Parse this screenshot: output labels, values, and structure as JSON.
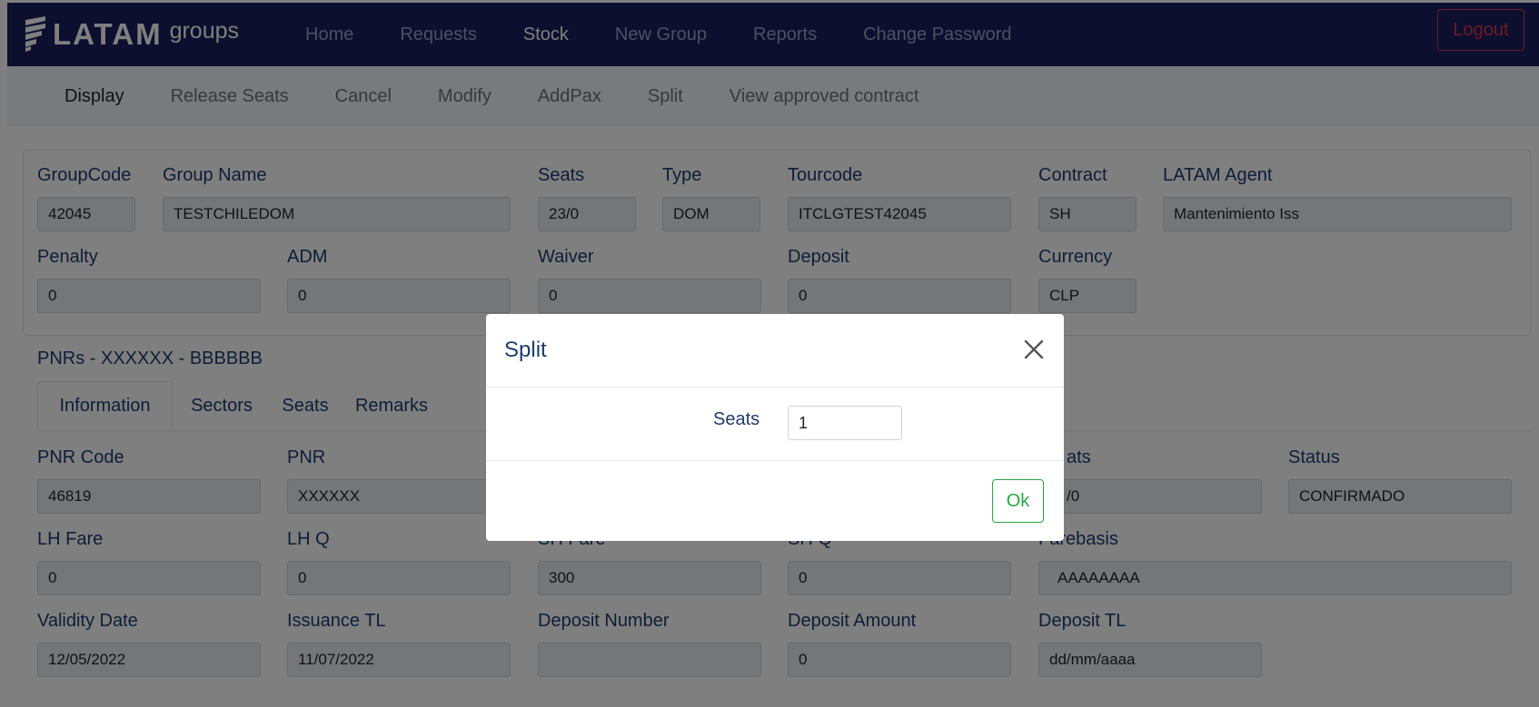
{
  "brand": {
    "name": "LATAM",
    "sub": "groups"
  },
  "nav": {
    "items": [
      "Home",
      "Requests",
      "Stock",
      "New Group",
      "Reports",
      "Change Password"
    ],
    "active": "Stock",
    "logout": "Logout"
  },
  "subnav": {
    "items": [
      "Display",
      "Release Seats",
      "Cancel",
      "Modify",
      "AddPax",
      "Split",
      "View approved contract"
    ]
  },
  "group": {
    "groupcode_label": "GroupCode",
    "groupcode": "42045",
    "groupname_label": "Group Name",
    "groupname": "TESTCHILEDOM",
    "seats_label": "Seats",
    "seats": "23/0",
    "type_label": "Type",
    "type": "DOM",
    "tourcode_label": "Tourcode",
    "tourcode": "ITCLGTEST42045",
    "contract_label": "Contract",
    "contract": "SH",
    "agent_label": "LATAM Agent",
    "agent": "Mantenimiento Iss",
    "penalty_label": "Penalty",
    "penalty": "0",
    "adm_label": "ADM",
    "adm": "0",
    "waiver_label": "Waiver",
    "waiver": "0",
    "deposit_label": "Deposit",
    "deposit": "0",
    "currency_label": "Currency",
    "currency": "CLP"
  },
  "pnrs": {
    "title": "PNRs - XXXXXX - BBBBBB",
    "tabs": [
      "Information",
      "Sectors",
      "Seats",
      "Remarks"
    ]
  },
  "pnr": {
    "code_label": "PNR Code",
    "code": "46819",
    "pnr_label": "PNR",
    "pnr": "XXXXXX",
    "seats_label_visible": "ats",
    "seats_visible": "/0",
    "status_label": "Status",
    "status": "CONFIRMADO",
    "lhfare_label": "LH Fare",
    "lhfare": "0",
    "lhq_label": "LH Q",
    "lhq": "0",
    "shfare_label": "SH Fare",
    "shfare": "300",
    "shq_label": "SH Q",
    "shq": "0",
    "farebasis_label": "Farebasis",
    "farebasis": "AAAAAAAA",
    "validity_label": "Validity Date",
    "validity": "12/05/2022",
    "issuance_label": "Issuance TL",
    "issuance": "11/07/2022",
    "depnum_label": "Deposit Number",
    "depnum": "",
    "depamt_label": "Deposit Amount",
    "depamt": "0",
    "deptl_label": "Deposit TL",
    "deptl": "dd/mm/aaaa"
  },
  "modal": {
    "title": "Split",
    "seats_label": "Seats",
    "seats_value": "1",
    "ok_label": "Ok"
  },
  "colors": {
    "navbar": "#1b1f5e",
    "logout": "#dc3545",
    "ok": "#28a745",
    "label": "#1f3b6e"
  }
}
